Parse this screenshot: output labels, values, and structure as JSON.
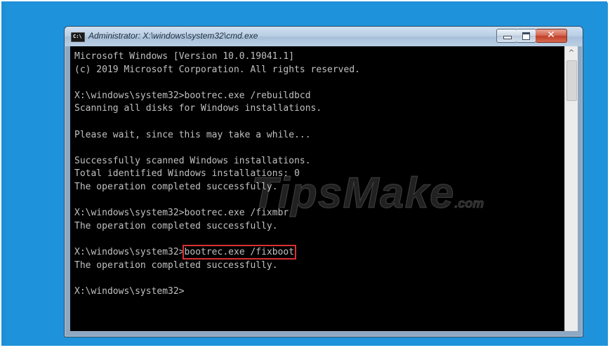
{
  "window": {
    "title": "Administrator: X:\\windows\\system32\\cmd.exe",
    "app_icon_text": "C:\\"
  },
  "controls": {
    "minimize": "–",
    "maximize": "□",
    "close": "✕"
  },
  "console": {
    "lines": [
      "Microsoft Windows [Version 10.0.19041.1]",
      "(c) 2019 Microsoft Corporation. All rights reserved.",
      "",
      "X:\\windows\\system32>bootrec.exe /rebuildbcd",
      "Scanning all disks for Windows installations.",
      "",
      "Please wait, since this may take a while...",
      "",
      "Successfully scanned Windows installations.",
      "Total identified Windows installations: 0",
      "The operation completed successfully.",
      "",
      "X:\\windows\\system32>bootrec.exe /fixmbr",
      "The operation completed successfully.",
      "",
      "X:\\windows\\system32>",
      "The operation completed successfully.",
      "",
      "X:\\windows\\system32>"
    ],
    "highlighted_command": "bootrec.exe /fixboot",
    "highlight_color": "#d93131",
    "text_color": "#c0c0c0",
    "background_color": "#000000"
  },
  "scrollbar": {
    "up_arrow": "^"
  },
  "watermark": {
    "text": "TipsMake",
    "suffix": ".com"
  }
}
